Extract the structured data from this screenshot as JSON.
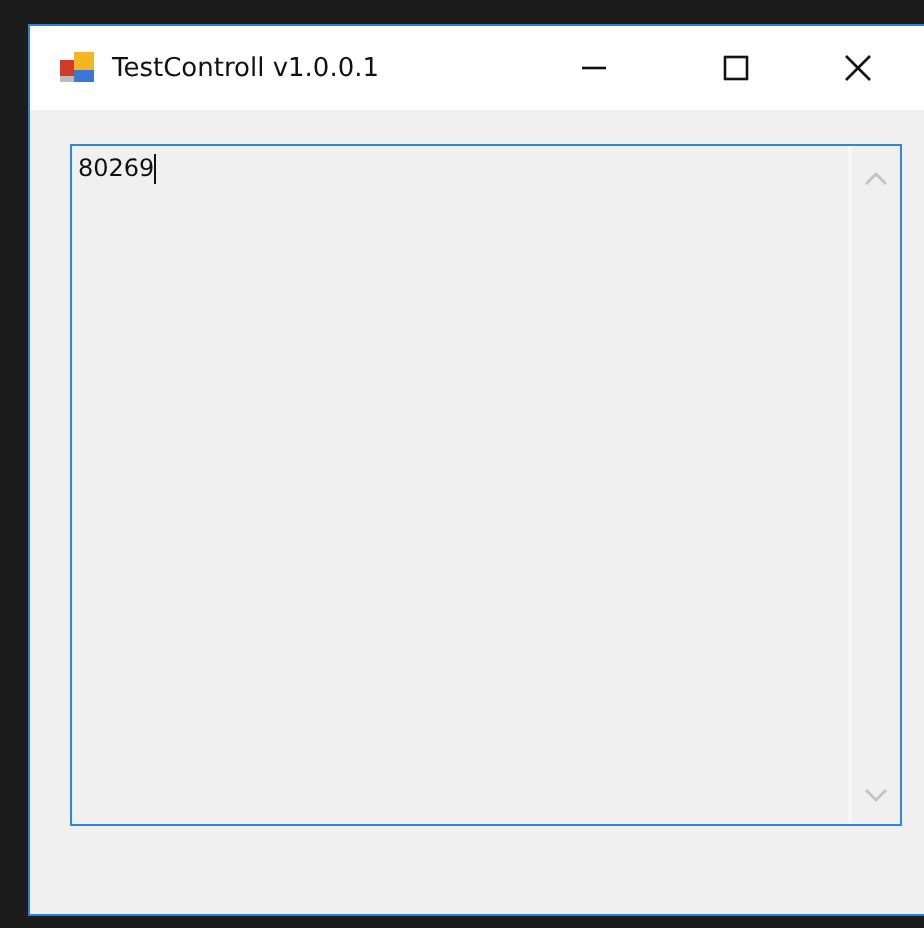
{
  "window": {
    "title": "TestControll v1.0.0.1"
  },
  "textbox": {
    "value": "80269"
  }
}
